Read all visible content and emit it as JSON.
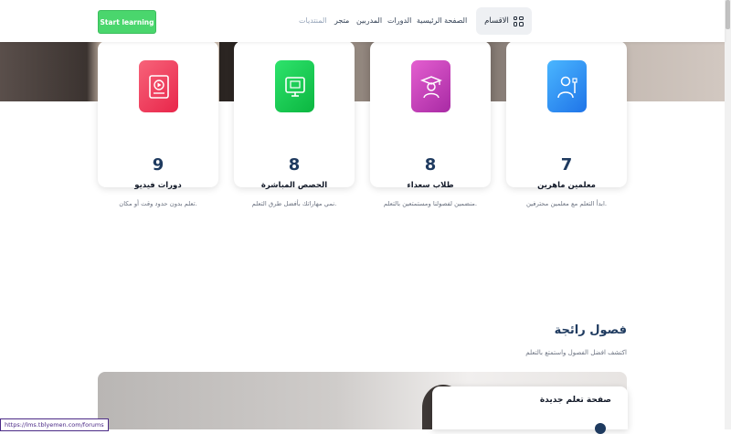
{
  "header": {
    "start_button": "Start learning",
    "categories_label": "الاقسام",
    "nav": [
      "الصفحة الرئيسية",
      "الدورات",
      "المدربين",
      "متجر",
      "المنتديات"
    ]
  },
  "stats": [
    {
      "number": "9",
      "title": "دورات فيديو",
      "desc": "تعلم بدون حدود وقت أو مكان.",
      "icon": "video-course-icon"
    },
    {
      "number": "8",
      "title": "الحصص المباشرة",
      "desc": "نمي مهاراتك بأفضل طرق التعلم.",
      "icon": "live-class-icon"
    },
    {
      "number": "8",
      "title": "طلاب سعداء",
      "desc": "منضمين لفصولنا ومستمتعين بالتعلم.",
      "icon": "graduate-icon"
    },
    {
      "number": "7",
      "title": "معلمين ماهرين",
      "desc": "ابدأ التعلم مع معلمين محترفين.",
      "icon": "teacher-icon"
    }
  ],
  "section": {
    "title": "فصول رائجة",
    "subtitle": "اكتشف افضل الفصول واستمتع بالتعلم",
    "card_title": "صفحة تعلم جديدة"
  },
  "status_url": "https://lms.tblyemen.com/forums",
  "colors": {
    "start_button": "#4ad66d",
    "heading": "#1e3a5f",
    "video_icon": "#f0455f",
    "live_icon": "#10c84a",
    "graduate_icon": "#c638b6",
    "teacher_icon": "#2f8df5"
  }
}
